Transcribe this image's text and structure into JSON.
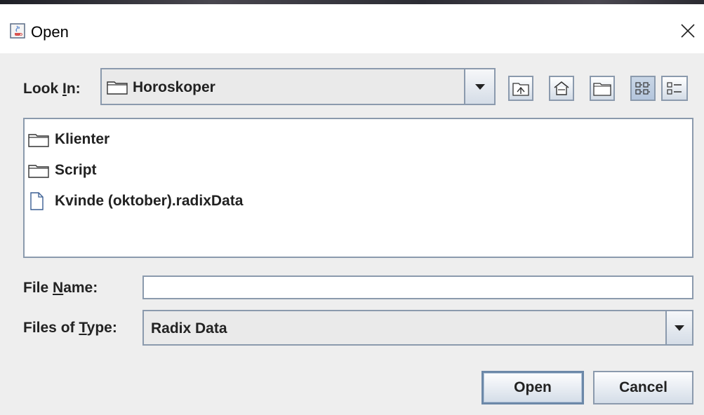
{
  "window": {
    "title": "Open",
    "close_label": "✕"
  },
  "look_in": {
    "label_pre": "Look ",
    "label_mnemonic": "I",
    "label_post": "n:",
    "value": "Horoskoper"
  },
  "toolbar": {
    "buttons": [
      {
        "name": "up-one-level",
        "icon": "folder-up-icon"
      },
      {
        "name": "home",
        "icon": "home-icon"
      },
      {
        "name": "new-folder",
        "icon": "new-folder-icon"
      },
      {
        "name": "list-view",
        "icon": "list-view-icon",
        "active": true
      },
      {
        "name": "details-view",
        "icon": "details-view-icon"
      }
    ]
  },
  "files": [
    {
      "name": "Klienter",
      "type": "folder"
    },
    {
      "name": "Script",
      "type": "folder"
    },
    {
      "name": "Kvinde (oktober).radixData",
      "type": "file"
    }
  ],
  "file_name": {
    "label_pre": "File ",
    "label_mnemonic": "N",
    "label_post": "ame:",
    "value": "",
    "placeholder": ""
  },
  "file_type": {
    "label_pre": "Files of ",
    "label_mnemonic": "T",
    "label_post": "ype:",
    "value": "Radix Data"
  },
  "buttons": {
    "open": "Open",
    "cancel": "Cancel"
  },
  "colors": {
    "border": "#8b9aad",
    "background": "#eeeeee",
    "accent": "#6c88a8"
  }
}
